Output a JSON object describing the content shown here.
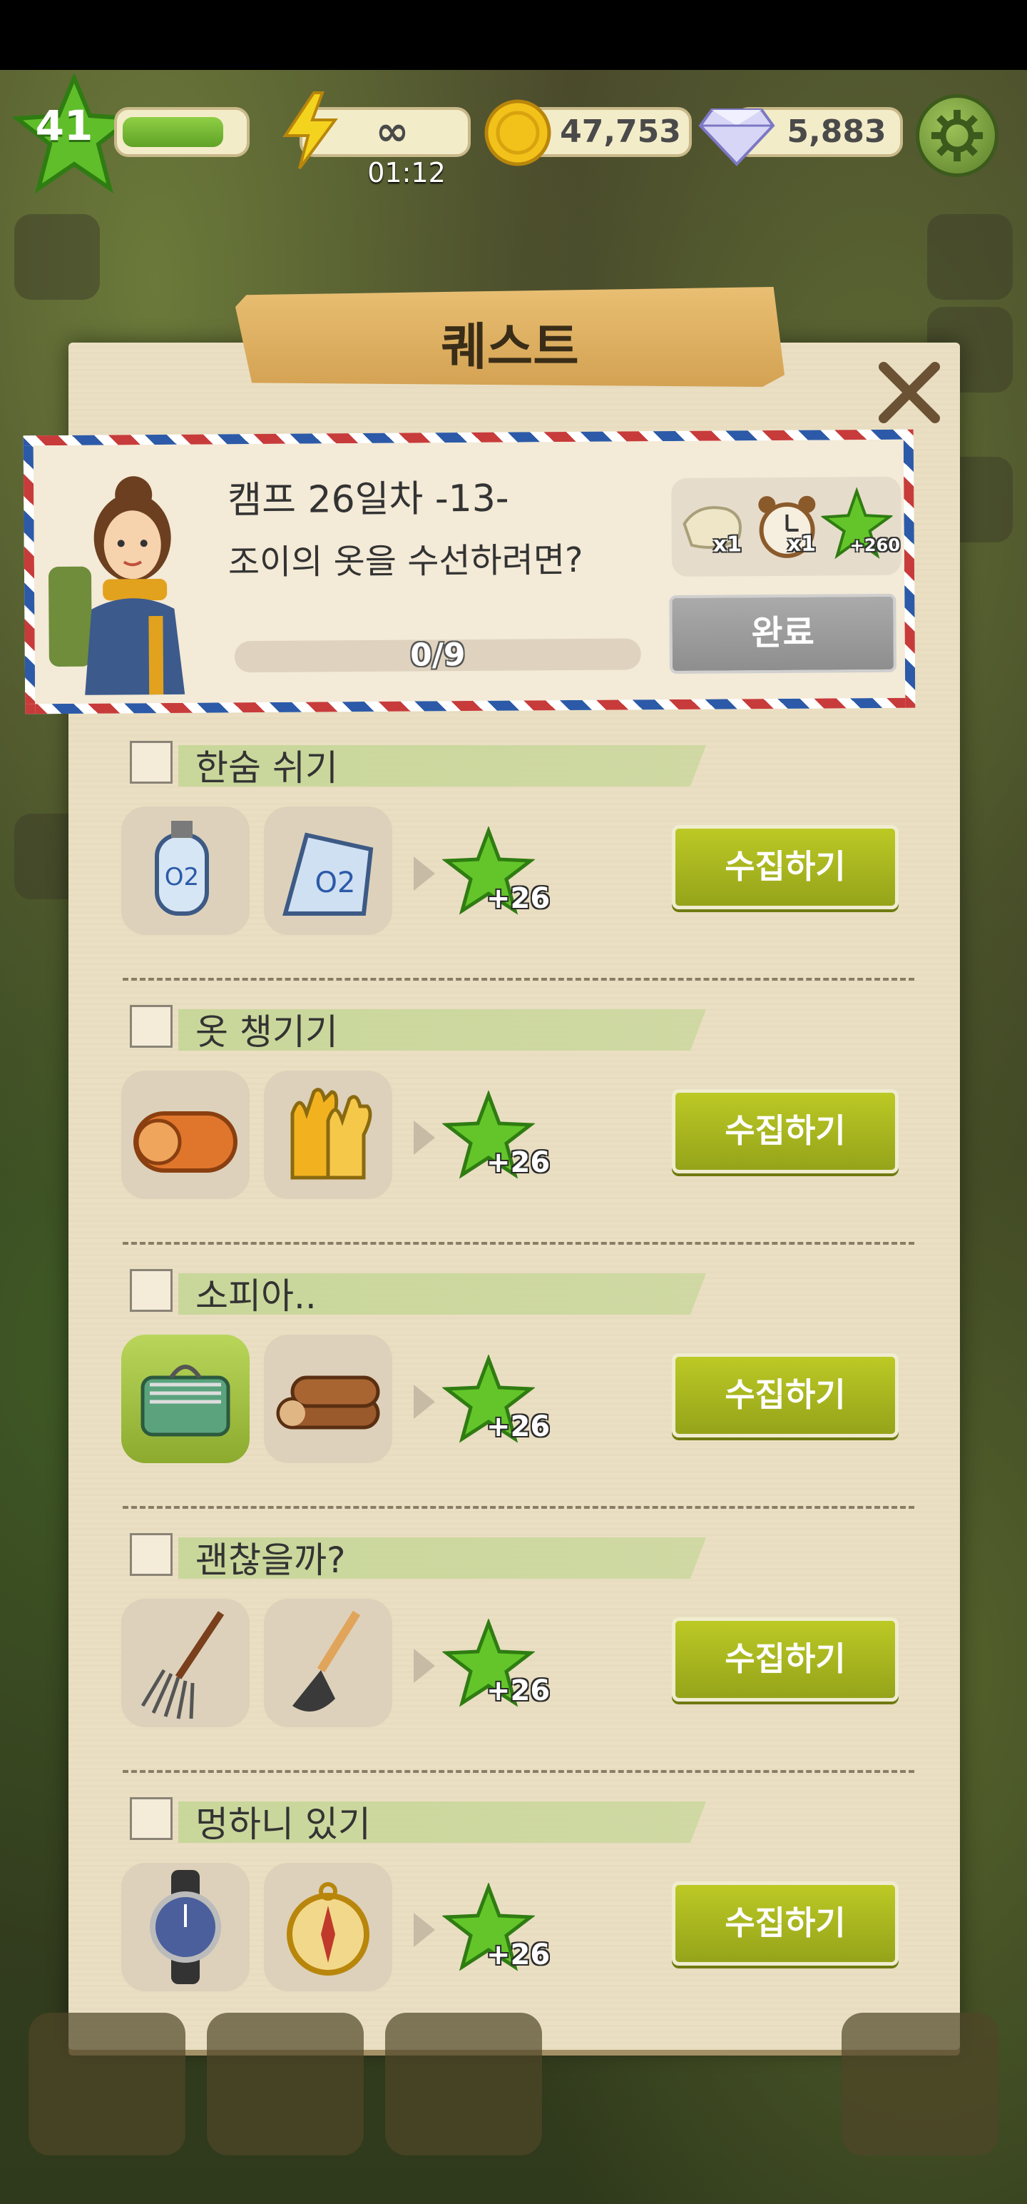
{
  "hud": {
    "level": "41",
    "xp_progress": 0.85,
    "energy": "∞",
    "energy_timer": "01:12",
    "coins": "47,753",
    "gems": "5,883"
  },
  "panel": {
    "title": "퀘스트"
  },
  "quest": {
    "chapter": "캠프 26일차 -13-",
    "title": "조이의 옷을 수선하려면?",
    "progress_text": "0/9",
    "progress_value": 0,
    "rewards": [
      {
        "icon": "cloth-bundle-icon",
        "qty": "x1"
      },
      {
        "icon": "alarm-clock-icon",
        "qty": "x1"
      },
      {
        "icon": "green-star-icon",
        "qty": "+260"
      }
    ],
    "complete_label": "완료"
  },
  "tasks": [
    {
      "label": "한숨 쉬기",
      "items": [
        "oxygen-tank-icon",
        "oxygen-bag-icon"
      ],
      "star_qty": "+26",
      "button": "수집하기"
    },
    {
      "label": "옷 챙기기",
      "items": [
        "sleeping-mat-icon",
        "work-gloves-icon"
      ],
      "star_qty": "+26",
      "button": "수집하기"
    },
    {
      "label": "소피아..",
      "items": [
        "grill-icon",
        "firewood-icon"
      ],
      "star_qty": "+26",
      "button": "수집하기"
    },
    {
      "label": "괜찮을까?",
      "items": [
        "rake-icon",
        "hoe-icon"
      ],
      "star_qty": "+26",
      "button": "수집하기"
    },
    {
      "label": "멍하니 있기",
      "items": [
        "wristwatch-icon",
        "compass-icon"
      ],
      "star_qty": "+26",
      "button": "수집하기"
    }
  ],
  "colors": {
    "accent_green": "#95a31a",
    "panel": "#eadfc2",
    "banner": "#d4a253"
  }
}
